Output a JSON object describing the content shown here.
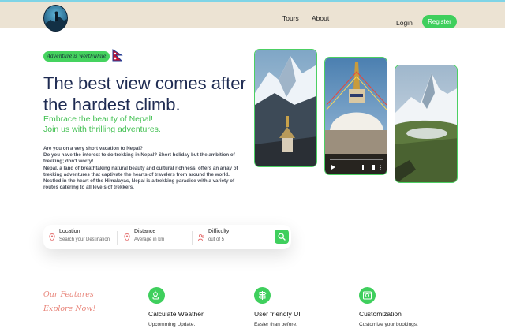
{
  "nav": {
    "links": [
      "Tours",
      "About"
    ],
    "login": "Login",
    "register": "Register"
  },
  "hero": {
    "tagline": "Adventure is worthwhile",
    "title_line1": "The best view comes after",
    "title_line2": "the hardest climb.",
    "sub_line1": "Embrace the beauty of Nepal!",
    "sub_line2": "Join us with thrilling adventures.",
    "para": [
      "Are you on a very short vacation to Nepal?",
      "Do you have the interest to do trekking in Nepal? Short holiday but the ambition of",
      "trekking; don't worry!",
      "Nepal, a land of breathtaking natural beauty and cultural richness, offers an array of",
      "trekking adventures that captivate the hearts of travelers from around the world.",
      "Nestled in the heart of the Himalayas, Nepal is a trekking paradise with a variety of",
      "routes catering to all levels of trekkers."
    ]
  },
  "search": {
    "location_label": "Location",
    "location_placeholder": "Search your Destination",
    "distance_label": "Distance",
    "distance_placeholder": "Average in km",
    "difficulty_label": "Difficulty",
    "difficulty_placeholder": "out of 5"
  },
  "features": {
    "script_line1": "Our Features",
    "script_line2": "Explore Now!",
    "items": [
      {
        "title": "Calculate Weather",
        "desc": "Upcomming Update.",
        "icon": "weather-icon"
      },
      {
        "title": "User friendly UI",
        "desc": "Easier than before.",
        "icon": "signpost-icon"
      },
      {
        "title": "Customization",
        "desc": "Customize your bookings.",
        "icon": "settings-icon"
      }
    ]
  },
  "colors": {
    "accent": "#3fcf5d",
    "header_bg": "#ece3d3",
    "title": "#1e2b52",
    "script": "#e8857a"
  }
}
